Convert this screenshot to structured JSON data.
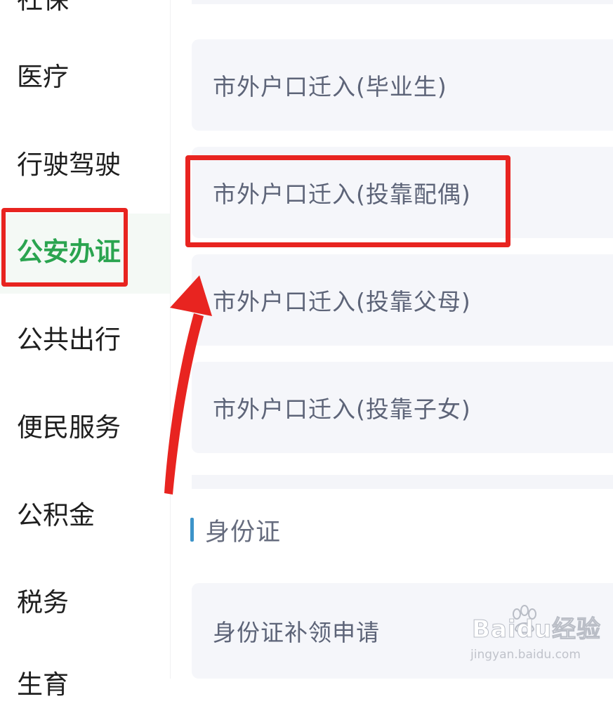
{
  "sidebar": {
    "items": [
      {
        "label": "社保",
        "active": false
      },
      {
        "label": "医疗",
        "active": false
      },
      {
        "label": "行驶驾驶",
        "active": false
      },
      {
        "label": "公安办证",
        "active": true
      },
      {
        "label": "公共出行",
        "active": false
      },
      {
        "label": "便民服务",
        "active": false
      },
      {
        "label": "公积金",
        "active": false
      },
      {
        "label": "税务",
        "active": false
      },
      {
        "label": "生育",
        "active": false
      }
    ]
  },
  "main": {
    "services": [
      {
        "label": "市外户口迁入(毕业生)"
      },
      {
        "label": "市外户口迁入(投靠配偶)"
      },
      {
        "label": "市外户口迁入(投靠父母)"
      },
      {
        "label": "市外户口迁入(投靠子女)"
      }
    ],
    "section": {
      "title": "身份证",
      "services": [
        {
          "label": "身份证补领申请"
        }
      ]
    }
  },
  "watermark": {
    "brand": "Baidu经验",
    "url": "jingyan.baidu.com"
  },
  "colors": {
    "active_text": "#2aa44f",
    "annotation_red": "#e82420",
    "card_bg": "#f5f6fa",
    "card_text": "#5d6478",
    "section_bar": "#3c93c9"
  }
}
